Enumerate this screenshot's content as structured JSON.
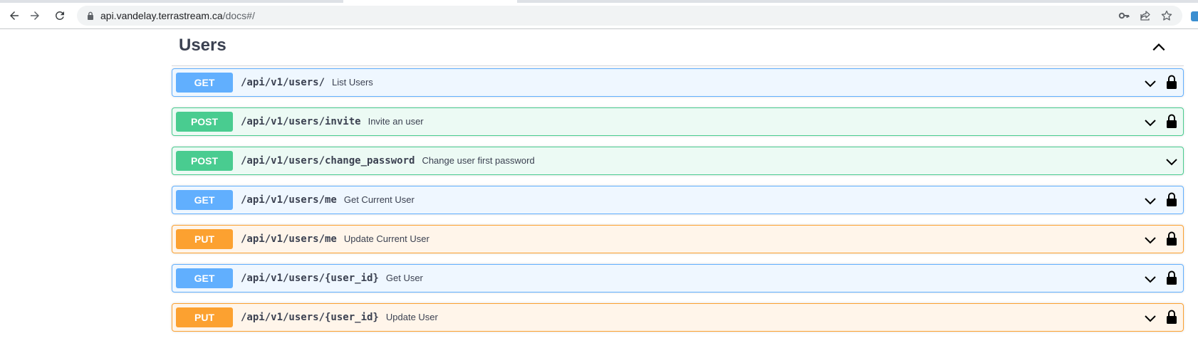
{
  "browser": {
    "url_domain": "api.vandelay.terrastream.ca",
    "url_path": "/docs#/",
    "icons": [
      "back-arrow-icon",
      "forward-arrow-icon",
      "reload-icon",
      "lock-icon",
      "key-icon",
      "share-icon",
      "star-icon"
    ]
  },
  "section": {
    "title": "Users",
    "icon": "chevron-up-icon"
  },
  "operations": [
    {
      "method": "GET",
      "path": "/api/v1/users/",
      "summary": "List Users",
      "locked": true
    },
    {
      "method": "POST",
      "path": "/api/v1/users/invite",
      "summary": "Invite an user",
      "locked": true
    },
    {
      "method": "POST",
      "path": "/api/v1/users/change_password",
      "summary": "Change user first password",
      "locked": false
    },
    {
      "method": "GET",
      "path": "/api/v1/users/me",
      "summary": "Get Current User",
      "locked": true
    },
    {
      "method": "PUT",
      "path": "/api/v1/users/me",
      "summary": "Update Current User",
      "locked": true
    },
    {
      "method": "GET",
      "path": "/api/v1/users/{user_id}",
      "summary": "Get User",
      "locked": true
    },
    {
      "method": "PUT",
      "path": "/api/v1/users/{user_id}",
      "summary": "Update User",
      "locked": true
    }
  ],
  "colors": {
    "get": "#61affe",
    "post": "#49cc90",
    "put": "#fca130",
    "text": "#3b4151"
  }
}
